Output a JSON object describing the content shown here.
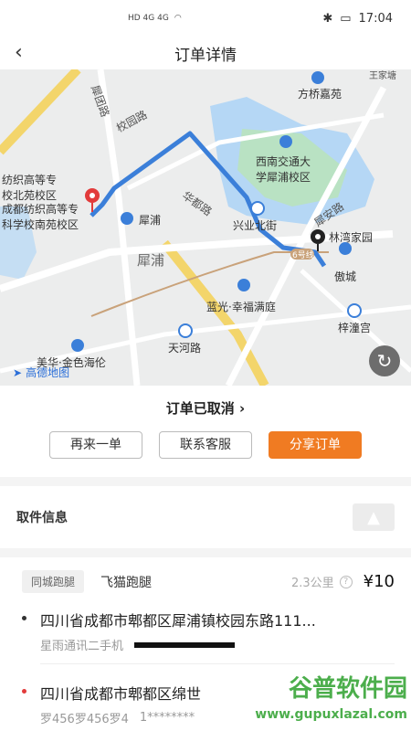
{
  "status_bar": {
    "left_icons": "HD 4G 4G",
    "time": "17:04",
    "battery_icon": "battery-icon",
    "bluetooth_icon": "bluetooth-icon"
  },
  "header": {
    "title": "订单详情",
    "back_icon": "chevron-left-icon"
  },
  "map": {
    "labels": {
      "school_road": "校园路",
      "bridge_road": "犀团路",
      "textile_north": "纺织高等专\n校北苑校区",
      "textile_school": "成都纺织高等专\n科学校南苑校区",
      "xipu": "犀浦",
      "xipu_metro": "犀浦",
      "huadu": "华都路",
      "xingye": "兴业北街",
      "xian": "犀安路",
      "linwan": "林湾家园",
      "aocheng": "傲城",
      "swjtu": "西南交通大\n学犀浦校区",
      "fangqiao": "方桥嘉苑",
      "landmark_top": "王家塘",
      "lanting": "蓝光·幸福满庭",
      "tianhe": "天河路",
      "meihua": "美华·金色海伦",
      "zhitong": "梓潼宫",
      "metro_line": "6号线"
    },
    "logo_text": "高德地图",
    "refresh_icon": "refresh-icon",
    "colors": {
      "route": "#3b7fd9",
      "major_road": "#f3d56b",
      "water": "#b5d7f5",
      "park": "#b9e2c3"
    }
  },
  "status_card": {
    "order_status": "订单已取消",
    "buttons": [
      "再来一单",
      "联系客服",
      "分享订单"
    ]
  },
  "pickup": {
    "title": "取件信息",
    "image_icon": "image-placeholder-icon"
  },
  "delivery": {
    "tag": "同城跑腿",
    "service": "飞猫跑腿",
    "distance": "2.3公里",
    "price": "¥10",
    "from": {
      "address": "四川省成都市郫都区犀浦镇校园东路111...",
      "contact": "星雨通讯二手机"
    },
    "to": {
      "address": "四川省成都市郫都区绵世",
      "contact": "罗456罗456罗4",
      "phone_partial": "1********"
    }
  },
  "watermark": {
    "text": "谷普软件园",
    "url": "www.gupuxlazal.com"
  }
}
